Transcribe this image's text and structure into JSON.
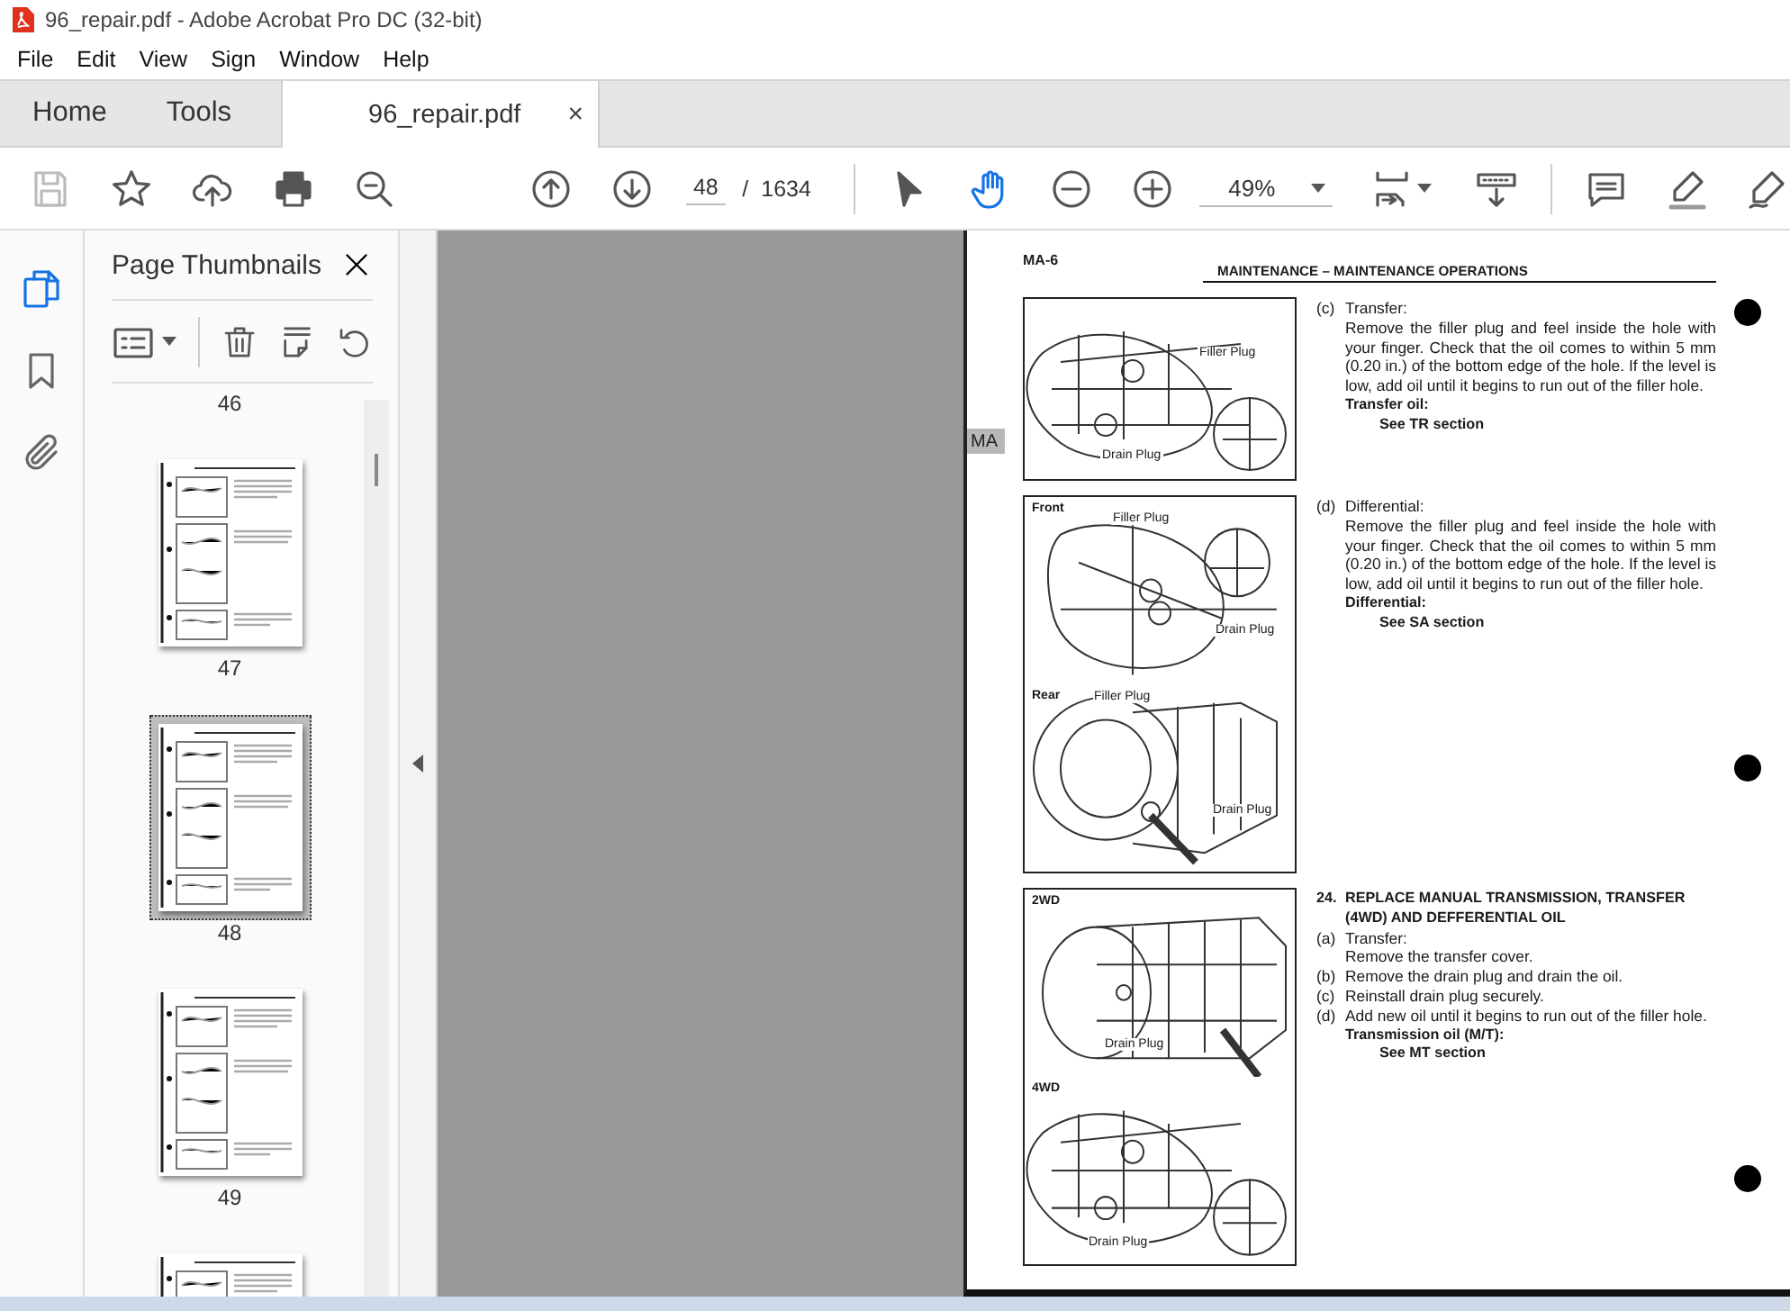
{
  "window": {
    "title": "96_repair.pdf - Adobe Acrobat Pro DC (32-bit)"
  },
  "menu": [
    "File",
    "Edit",
    "View",
    "Sign",
    "Window",
    "Help"
  ],
  "tabs": [
    {
      "label": "Home",
      "selected": false
    },
    {
      "label": "Tools",
      "selected": false
    },
    {
      "label": "96_repair.pdf",
      "selected": true,
      "close": "×"
    }
  ],
  "toolbar": {
    "actions": [
      {
        "kind": "save",
        "disabled": true
      },
      {
        "kind": "star",
        "disabled": false
      },
      {
        "kind": "upload",
        "disabled": false
      },
      {
        "kind": "print",
        "disabled": false
      },
      {
        "kind": "zoom-search",
        "disabled": false
      },
      {
        "kind": "page-up",
        "disabled": false
      },
      {
        "kind": "page-down",
        "disabled": false
      }
    ],
    "page_number": "48",
    "page_separator": "/",
    "page_count": "1634",
    "tools": [
      {
        "kind": "cursor",
        "selected": false
      },
      {
        "kind": "hand",
        "selected": true
      },
      {
        "kind": "zoom-out",
        "selected": false
      },
      {
        "kind": "zoom-in",
        "selected": false
      }
    ],
    "zoom": "49%",
    "extras": [
      {
        "kind": "fit-page"
      },
      {
        "kind": "scroll-mode"
      },
      {
        "kind": "comment"
      },
      {
        "kind": "highlight"
      },
      {
        "kind": "sign"
      }
    ]
  },
  "sidebar": {
    "rail": [
      {
        "kind": "pages",
        "selected": true
      },
      {
        "kind": "bookmarks",
        "selected": false
      },
      {
        "kind": "attachments",
        "selected": false
      }
    ],
    "title": "Page Thumbnails",
    "thumbnails": [
      {
        "page": "46",
        "image": false,
        "selected": false
      },
      {
        "page": "47",
        "image": true,
        "selected": false
      },
      {
        "page": "48",
        "image": true,
        "selected": true
      },
      {
        "page": "49",
        "image": true,
        "selected": false
      },
      {
        "image": true,
        "selected": false
      }
    ]
  },
  "document": {
    "page_code": "MA-6",
    "page_title": "MAINTENANCE – MAINTENANCE OPERATIONS",
    "side_tab": "MA",
    "sections": [
      {
        "figure": [
          {
            "callouts": [
              "Filler Plug",
              "Drain Plug"
            ]
          }
        ],
        "steps": [
          {
            "marker": "(c)",
            "title": "Transfer:",
            "body": "Remove the filler plug and feel inside the hole with your finger. Check that the oil comes to within 5 mm (0.20 in.) of the bottom edge of the hole. If the level is low, add oil until it begins to run out of the filler hole."
          }
        ],
        "spec_label": "Transfer oil:",
        "spec_value": "See TR section"
      },
      {
        "figure": [
          {
            "caption": "Front",
            "callouts": [
              "Filler Plug",
              "Drain Plug"
            ]
          },
          {
            "caption": "Rear",
            "callouts": [
              "Filler Plug",
              "Drain Plug"
            ]
          }
        ],
        "steps": [
          {
            "marker": "(d)",
            "title": "Differential:",
            "body": "Remove the filler plug and feel inside the hole with your finger. Check that the oil comes to within 5 mm (0.20 in.) of the bottom edge of the hole. If the level is low, add oil until it begins to run out of the filler hole."
          }
        ],
        "spec_label": "Differential:",
        "spec_value": "See SA section"
      },
      {
        "figure": [
          {
            "caption": "2WD",
            "callouts": [
              "Drain Plug"
            ]
          },
          {
            "caption": "4WD",
            "callouts": [
              "Drain Plug"
            ]
          }
        ],
        "number": "24.",
        "heading": "REPLACE MANUAL TRANSMISSION, TRANSFER (4WD) AND DEFFERENTIAL OIL",
        "steps": [
          {
            "marker": "(a)",
            "title": "Transfer:",
            "body": "Remove the transfer cover."
          },
          {
            "marker": "(b)",
            "body": "Remove the drain plug and drain the oil."
          },
          {
            "marker": "(c)",
            "body": "Reinstall drain plug securely."
          },
          {
            "marker": "(d)",
            "body": "Add new oil until it begins to run out of the filler hole."
          }
        ],
        "spec_label": "Transmission oil (M/T):",
        "spec_value": "See MT section"
      }
    ]
  }
}
